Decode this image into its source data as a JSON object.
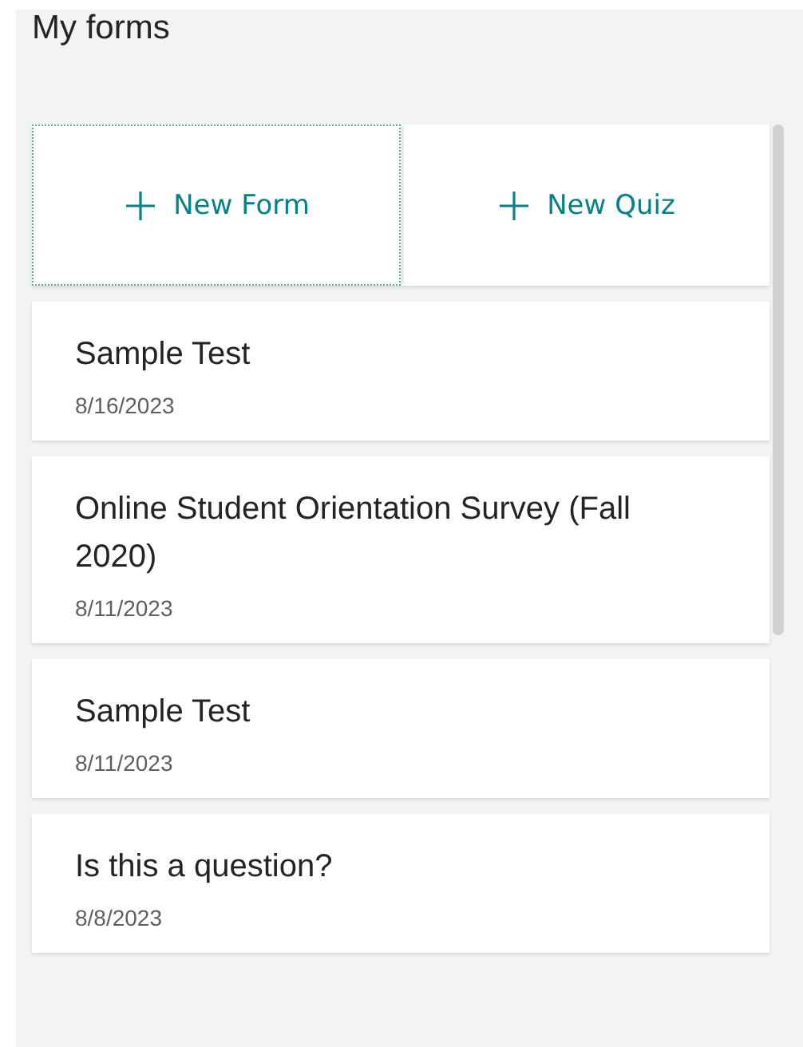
{
  "title": "My forms",
  "actions": [
    {
      "label": "New Form",
      "focused": true
    },
    {
      "label": "New Quiz",
      "focused": false
    }
  ],
  "forms": [
    {
      "name": "Sample Test",
      "date": "8/16/2023"
    },
    {
      "name": "Online Student Orientation Survey (Fall 2020)",
      "date": "8/11/2023"
    },
    {
      "name": "Sample Test",
      "date": "8/11/2023"
    },
    {
      "name": "Is this a question?",
      "date": "8/8/2023"
    }
  ]
}
